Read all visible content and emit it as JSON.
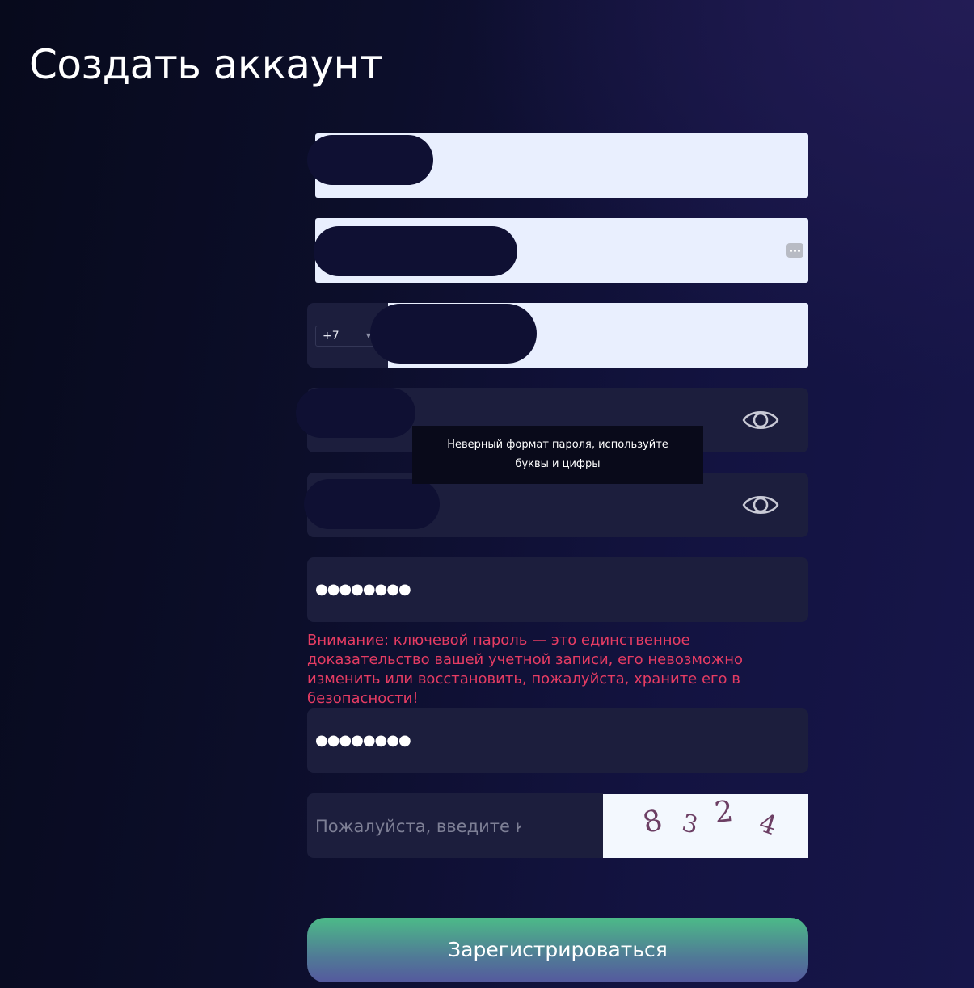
{
  "page": {
    "title": "Создать аккаунт"
  },
  "form": {
    "phone": {
      "country_code": "+7"
    },
    "password_tooltip": "Неверный формат пароля, используйте буквы и цифры",
    "key_password": {
      "value": "●●●●●●●●"
    },
    "warning": "Внимание: ключевой пароль — это единственное доказательство вашей учетной записи, его невозможно изменить или восстановить, пожалуйста, храните его в безопасности!",
    "key_password_confirm": {
      "value": "●●●●●●●●"
    },
    "captcha": {
      "placeholder": "Пожалуйста, введите к",
      "digits": [
        "8",
        "3",
        "2",
        "4"
      ]
    },
    "submit_label": "Зарегистрироваться"
  },
  "icons": {
    "password_visibility": "eye-icon",
    "password_autofill": "keyboard-icon"
  },
  "colors": {
    "warning": "#e63c63",
    "button_gradient_top": "#4cba88",
    "button_gradient_bottom": "#55599e",
    "field_background": "#1c1e3d",
    "input_background_light": "#e9effe"
  }
}
